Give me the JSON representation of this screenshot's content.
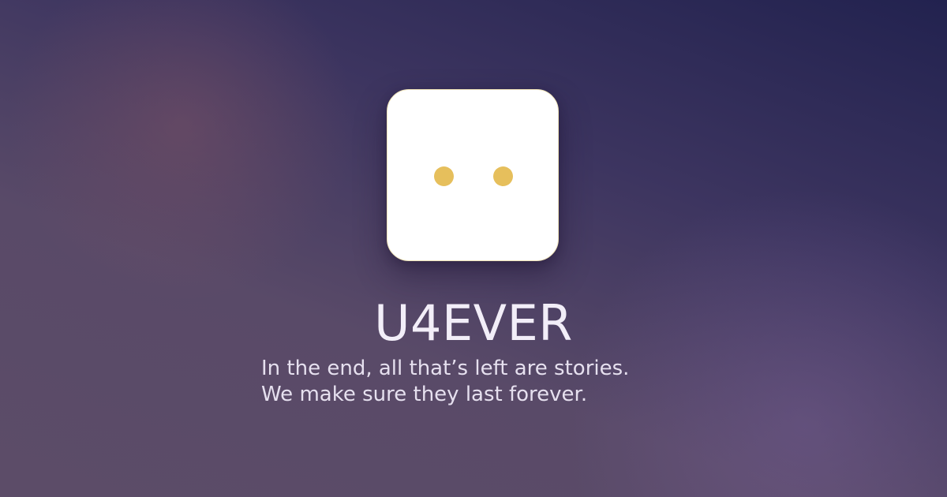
{
  "brand": {
    "name": "U4EVER",
    "logo_icon": "smiley-face-icon",
    "eye_color": "#e6bf5c"
  },
  "tagline": {
    "line1": "In the end, all that’s left are stories.",
    "line2": "We make sure they last forever."
  }
}
